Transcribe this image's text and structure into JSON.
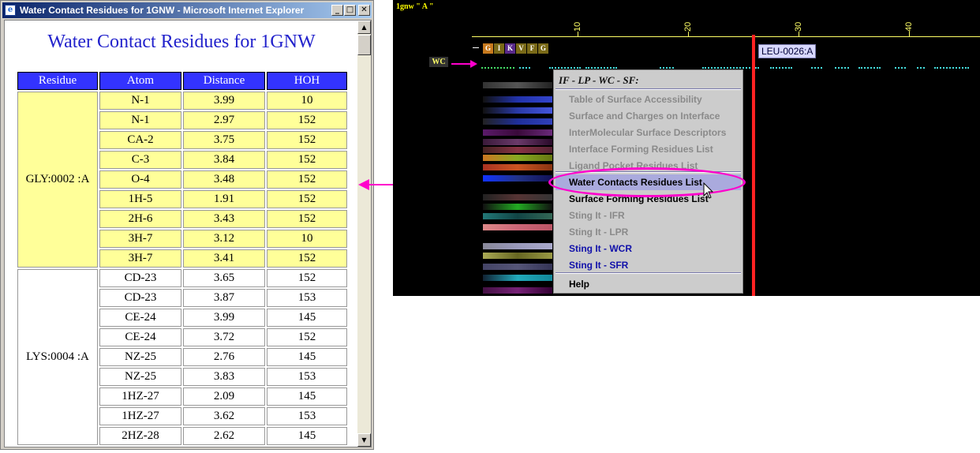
{
  "ie_window": {
    "title": "Water Contact Residues for 1GNW - Microsoft Internet Explorer",
    "title_icon": "e",
    "minimize_glyph": "_",
    "maximize_glyph": "□",
    "close_glyph": "✕",
    "scroll_up_glyph": "▲",
    "scroll_down_glyph": "▼"
  },
  "page": {
    "heading": "Water Contact Residues for 1GNW",
    "table": {
      "headers": [
        "Residue",
        "Atom",
        "Distance",
        "HOH"
      ],
      "groups": [
        {
          "residue": "GLY:0002 :A",
          "highlight": true,
          "rows": [
            [
              "N-1",
              "3.99",
              "10"
            ],
            [
              "N-1",
              "2.97",
              "152"
            ],
            [
              "CA-2",
              "3.75",
              "152"
            ],
            [
              "C-3",
              "3.84",
              "152"
            ],
            [
              "O-4",
              "3.48",
              "152"
            ],
            [
              "1H-5",
              "1.91",
              "152"
            ],
            [
              "2H-6",
              "3.43",
              "152"
            ],
            [
              "3H-7",
              "3.12",
              "10"
            ],
            [
              "3H-7",
              "3.41",
              "152"
            ]
          ]
        },
        {
          "residue": "LYS:0004 :A",
          "highlight": false,
          "rows": [
            [
              "CD-23",
              "3.65",
              "152"
            ],
            [
              "CD-23",
              "3.87",
              "153"
            ],
            [
              "CE-24",
              "3.99",
              "145"
            ],
            [
              "CE-24",
              "3.72",
              "152"
            ],
            [
              "NZ-25",
              "2.76",
              "145"
            ],
            [
              "NZ-25",
              "3.83",
              "153"
            ],
            [
              "1HZ-27",
              "2.09",
              "145"
            ],
            [
              "1HZ-27",
              "3.62",
              "153"
            ],
            [
              "2HZ-28",
              "2.62",
              "145"
            ]
          ]
        }
      ]
    }
  },
  "viewer": {
    "title": "1gnw \" A \"",
    "ruler_labels": [
      "10",
      "20",
      "30",
      "40"
    ],
    "sequence": [
      "G",
      "I",
      "K",
      "V",
      "F",
      "G"
    ],
    "sequence_colors": [
      "#c87a1e",
      "#7a6a18",
      "#5a2a8a",
      "#7a6a18",
      "#7a6a18",
      "#7a6a18"
    ],
    "track_label": "WC",
    "cursor_label": "LEU-0026:A",
    "accent_color": "#ff00cc",
    "cursor_color": "#ff2222",
    "context_menu": {
      "header": "IF - LP - WC - SF:",
      "items": [
        {
          "label": "Table of Surface Accessibility",
          "state": "disabled"
        },
        {
          "label": "Surface and Charges on Interface",
          "state": "disabled"
        },
        {
          "label": "InterMolecular Surface Descriptors",
          "state": "disabled"
        },
        {
          "label": "Interface Forming Residues List",
          "state": "disabled"
        },
        {
          "label": "Ligand Pocket Residues List",
          "state": "disabled"
        },
        {
          "label": "Water Contacts Residues List",
          "state": "selected"
        },
        {
          "label": "Surface Forming Residues List",
          "state": "enabled"
        },
        {
          "label": "Sting It - IFR",
          "state": "disabled"
        },
        {
          "label": "Sting It - LPR",
          "state": "disabled"
        },
        {
          "label": "Sting It - WCR",
          "state": "link"
        },
        {
          "label": "Sting It - SFR",
          "state": "link"
        },
        {
          "label": "Help",
          "state": "enabled"
        }
      ]
    }
  }
}
